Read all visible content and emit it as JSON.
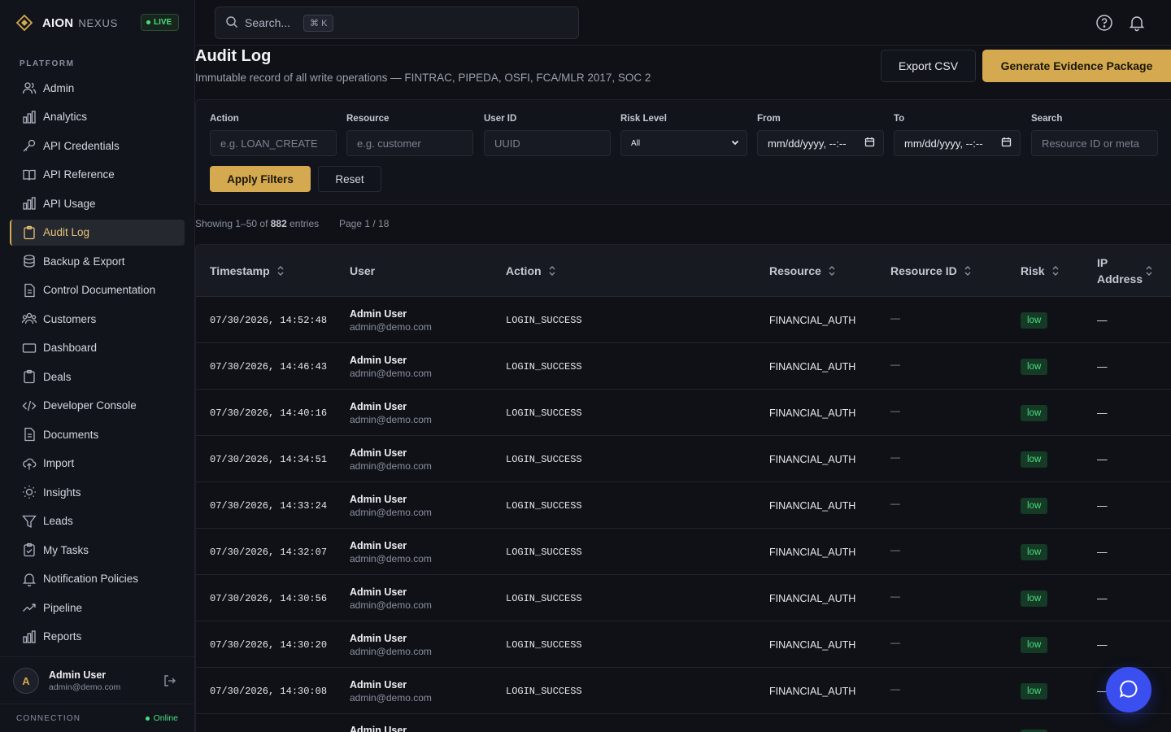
{
  "brand": {
    "name": "AION",
    "sub": "NEXUS",
    "live": "LIVE"
  },
  "sidebar": {
    "section": "PLATFORM",
    "items": [
      {
        "label": "Admin",
        "icon": "users-icon"
      },
      {
        "label": "Analytics",
        "icon": "bar-chart-icon"
      },
      {
        "label": "API Credentials",
        "icon": "key-icon"
      },
      {
        "label": "API Reference",
        "icon": "book-icon"
      },
      {
        "label": "API Usage",
        "icon": "bar-chart-icon"
      },
      {
        "label": "Audit Log",
        "icon": "clipboard-icon",
        "active": true
      },
      {
        "label": "Backup & Export",
        "icon": "database-icon"
      },
      {
        "label": "Control Documentation",
        "icon": "file-icon"
      },
      {
        "label": "Customers",
        "icon": "users-group-icon"
      },
      {
        "label": "Dashboard",
        "icon": "monitor-icon"
      },
      {
        "label": "Deals",
        "icon": "clipboard-icon"
      },
      {
        "label": "Developer Console",
        "icon": "code-icon"
      },
      {
        "label": "Documents",
        "icon": "file-icon"
      },
      {
        "label": "Import",
        "icon": "cloud-upload-icon"
      },
      {
        "label": "Insights",
        "icon": "lightbulb-icon"
      },
      {
        "label": "Leads",
        "icon": "funnel-icon"
      },
      {
        "label": "My Tasks",
        "icon": "clipboard-check-icon"
      },
      {
        "label": "Notification Policies",
        "icon": "bell-icon"
      },
      {
        "label": "Pipeline",
        "icon": "trending-icon"
      },
      {
        "label": "Reports",
        "icon": "bar-chart-icon"
      }
    ],
    "user": {
      "initial": "A",
      "name": "Admin User",
      "email": "admin@demo.com"
    },
    "connection": {
      "label": "CONNECTION",
      "status": "Online"
    }
  },
  "topbar": {
    "search_placeholder": "Search...",
    "shortcut": "⌘ K"
  },
  "page": {
    "title": "Audit Log",
    "subtitle": "Immutable record of all write operations — FINTRAC, PIPEDA, OSFI, FCA/MLR 2017, SOC 2",
    "export_label": "Export CSV",
    "evidence_label": "Generate Evidence Package"
  },
  "filters": {
    "action": {
      "label": "Action",
      "placeholder": "e.g. LOAN_CREATE"
    },
    "resource": {
      "label": "Resource",
      "placeholder": "e.g. customer"
    },
    "user_id": {
      "label": "User ID",
      "placeholder": "UUID"
    },
    "risk": {
      "label": "Risk Level",
      "value": "All"
    },
    "from": {
      "label": "From",
      "value": "mm/dd/yyyy, --:--"
    },
    "to": {
      "label": "To",
      "value": "mm/dd/yyyy, --:--"
    },
    "search": {
      "label": "Search",
      "placeholder": "Resource ID or meta"
    },
    "apply_label": "Apply Filters",
    "reset_label": "Reset"
  },
  "summary": {
    "prefix": "Showing 1–50 of",
    "total": "882",
    "suffix": "entries",
    "page": "Page 1 / 18"
  },
  "table": {
    "columns": [
      "Timestamp",
      "User",
      "Action",
      "Resource",
      "Resource ID",
      "Risk",
      "IP Address"
    ],
    "rows": [
      {
        "timestamp": "07/30/2026, 14:52:48",
        "user_name": "Admin User",
        "user_email": "admin@demo.com",
        "action": "LOGIN_SUCCESS",
        "resource": "FINANCIAL_AUTH",
        "resource_id": "—",
        "risk": "low",
        "ip": "—"
      },
      {
        "timestamp": "07/30/2026, 14:46:43",
        "user_name": "Admin User",
        "user_email": "admin@demo.com",
        "action": "LOGIN_SUCCESS",
        "resource": "FINANCIAL_AUTH",
        "resource_id": "—",
        "risk": "low",
        "ip": "—"
      },
      {
        "timestamp": "07/30/2026, 14:40:16",
        "user_name": "Admin User",
        "user_email": "admin@demo.com",
        "action": "LOGIN_SUCCESS",
        "resource": "FINANCIAL_AUTH",
        "resource_id": "—",
        "risk": "low",
        "ip": "—"
      },
      {
        "timestamp": "07/30/2026, 14:34:51",
        "user_name": "Admin User",
        "user_email": "admin@demo.com",
        "action": "LOGIN_SUCCESS",
        "resource": "FINANCIAL_AUTH",
        "resource_id": "—",
        "risk": "low",
        "ip": "—"
      },
      {
        "timestamp": "07/30/2026, 14:33:24",
        "user_name": "Admin User",
        "user_email": "admin@demo.com",
        "action": "LOGIN_SUCCESS",
        "resource": "FINANCIAL_AUTH",
        "resource_id": "—",
        "risk": "low",
        "ip": "—"
      },
      {
        "timestamp": "07/30/2026, 14:32:07",
        "user_name": "Admin User",
        "user_email": "admin@demo.com",
        "action": "LOGIN_SUCCESS",
        "resource": "FINANCIAL_AUTH",
        "resource_id": "—",
        "risk": "low",
        "ip": "—"
      },
      {
        "timestamp": "07/30/2026, 14:30:56",
        "user_name": "Admin User",
        "user_email": "admin@demo.com",
        "action": "LOGIN_SUCCESS",
        "resource": "FINANCIAL_AUTH",
        "resource_id": "—",
        "risk": "low",
        "ip": "—"
      },
      {
        "timestamp": "07/30/2026, 14:30:20",
        "user_name": "Admin User",
        "user_email": "admin@demo.com",
        "action": "LOGIN_SUCCESS",
        "resource": "FINANCIAL_AUTH",
        "resource_id": "—",
        "risk": "low",
        "ip": "—"
      },
      {
        "timestamp": "07/30/2026, 14:30:08",
        "user_name": "Admin User",
        "user_email": "admin@demo.com",
        "action": "LOGIN_SUCCESS",
        "resource": "FINANCIAL_AUTH",
        "resource_id": "—",
        "risk": "low",
        "ip": "—"
      },
      {
        "timestamp": "",
        "user_name": "Admin User",
        "user_email": "",
        "action": "",
        "resource": "",
        "resource_id": "",
        "risk": "low",
        "ip": ""
      }
    ]
  },
  "colors": {
    "accent": "#d4a94f",
    "live": "#4ade80",
    "fab": "#3b4ef0"
  },
  "fab": {
    "icon": "chat-bubble-icon"
  }
}
